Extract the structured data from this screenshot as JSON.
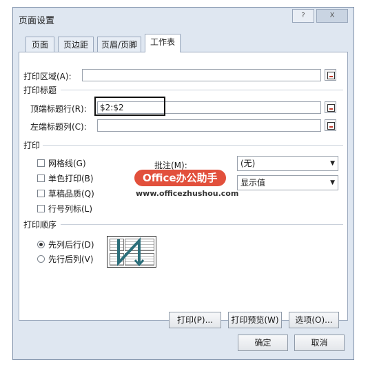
{
  "window": {
    "title": "页面设置",
    "help": "?",
    "close": "X"
  },
  "tabs": [
    "页面",
    "页边距",
    "页眉/页脚",
    "工作表"
  ],
  "print_area": {
    "label": "打印区域(A):",
    "value": ""
  },
  "print_titles": {
    "section": "打印标题",
    "rows_label": "顶端标题行(R):",
    "rows_value": "$2:$2",
    "cols_label": "左端标题列(C):",
    "cols_value": ""
  },
  "print": {
    "section": "打印",
    "gridlines": "网格线(G)",
    "mono": "单色打印(B)",
    "draft": "草稿品质(Q)",
    "headings": "行号列标(L)",
    "comments_label": "批注(M):",
    "comments_value": "(无)",
    "errors_value": "显示值"
  },
  "page_order": {
    "section": "打印顺序",
    "down_then_over": "先列后行(D)",
    "over_then_down": "先行后列(V)",
    "selected": "down_then_over"
  },
  "buttons": {
    "print": "打印(P)...",
    "preview": "打印预览(W)",
    "options": "选项(O)...",
    "ok": "确定",
    "cancel": "取消"
  },
  "watermark": {
    "badge": "Office办公助手",
    "url": "www.officezhushou.com"
  }
}
